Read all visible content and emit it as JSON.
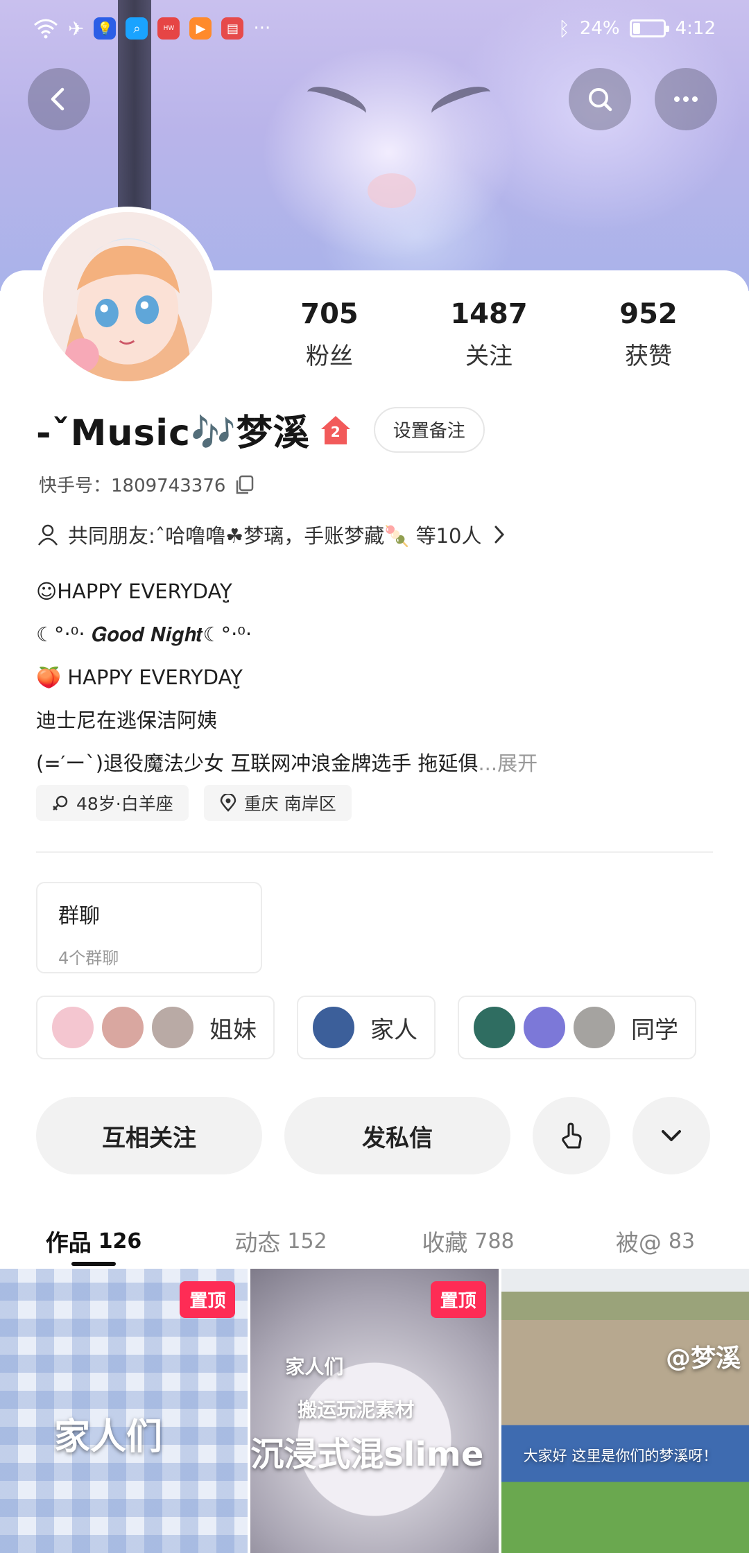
{
  "status_bar": {
    "battery_text": "24%",
    "battery_level": 0.24,
    "time": "4:12"
  },
  "profile": {
    "name": "-ˇMusic🎶梦溪",
    "home_badge_count": "2",
    "remark_button": "设置备注",
    "kuaishou_id": "快手号：1809743376",
    "stats": [
      {
        "value": "705",
        "label": "粉丝"
      },
      {
        "value": "1487",
        "label": "关注"
      },
      {
        "value": "952",
        "label": "获赞"
      }
    ],
    "mutual_friends": "共同朋友:ˆ哈噜噜☘梦璃，手账梦藏🍡 等10人",
    "bio": [
      "☺HAPPY EVERYDAY̤̮",
      "☾°‧⁰‧ 𝑮𝒐𝒐𝒅 𝑵𝒊𝒈𝒉𝒕☾°‧⁰‧",
      "🍑 HAPPY EVERYDAY̤̮",
      "迪士尼在逃保洁阿姨",
      "(=′ー`)退役魔法少女 互联网冲浪金牌选手 拖延俱"
    ],
    "bio_more": "...展开",
    "chips": [
      {
        "text": "48岁·白羊座",
        "icon": "gender-icon"
      },
      {
        "text": "重庆 南岸区",
        "icon": "location-pin-icon"
      }
    ]
  },
  "group_chat": {
    "title": "群聊",
    "subtitle": "4个群聊"
  },
  "friend_groups": [
    {
      "label": "姐妹",
      "avatar_colors": [
        "#f4c6d0",
        "#d9a7a0",
        "#b9aaa5"
      ]
    },
    {
      "label": "家人",
      "avatar_colors": [
        "#3c5f9a"
      ]
    },
    {
      "label": "同学",
      "avatar_colors": [
        "#2f6d61",
        "#7c78d8",
        "#a5a3a0"
      ]
    }
  ],
  "actions": {
    "mutual_follow": "互相关注",
    "message": "发私信"
  },
  "tabs": [
    {
      "label": "作品",
      "count": "126"
    },
    {
      "label": "动态",
      "count": "152"
    },
    {
      "label": "收藏",
      "count": "788"
    },
    {
      "label": "被@",
      "count": "83"
    }
  ],
  "videos": [
    {
      "pinned": "置顶",
      "caption": "家人们"
    },
    {
      "pinned": "置顶",
      "caption_top": "家人们",
      "caption_tag": "搬运玩泥素材",
      "caption": "沉浸式混slime"
    },
    {
      "watermark": "@梦溪",
      "caption": "大家好 这里是你们的梦溪呀！"
    }
  ],
  "colors": {
    "accent_red": "#fe2c55",
    "home_badge": "#f25a5a"
  }
}
